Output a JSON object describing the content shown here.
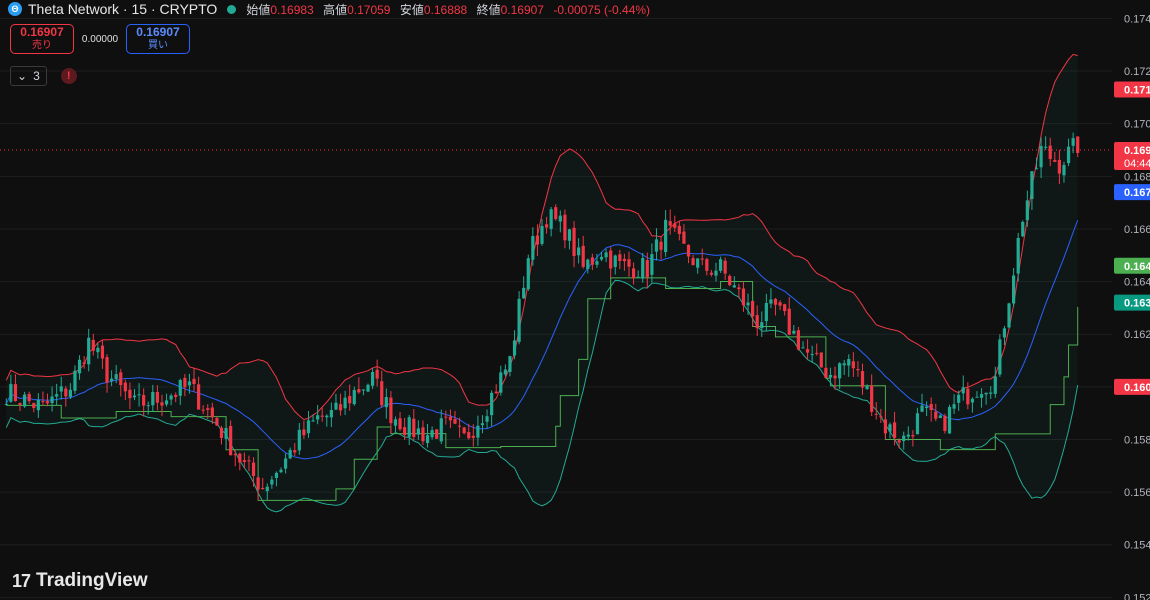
{
  "header": {
    "title": "Theta Network · 15 · CRYPTO",
    "icon": "theta-logo-icon",
    "ohlc": [
      {
        "label": "始値",
        "value": "0.16983"
      },
      {
        "label": "高値",
        "value": "0.17059"
      },
      {
        "label": "安値",
        "value": "0.16888"
      },
      {
        "label": "終値",
        "value": "0.16907"
      }
    ],
    "change": "-0.00075 (-0.44%)"
  },
  "trade": {
    "sell_price": "0.16907",
    "sell_label": "売り",
    "spread": "0.00000",
    "buy_price": "0.16907",
    "buy_label": "買い"
  },
  "indicators": {
    "count": "3",
    "warning": "!"
  },
  "logo": {
    "mark": "17",
    "text": "TradingView"
  },
  "colors": {
    "background": "#0f0f0f",
    "up": "#22ab94",
    "down": "#f23645",
    "bb_upper": "#f23645",
    "bb_lower": "#22ab94",
    "bb_basis": "#2962ff",
    "stop_line": "#4caf50"
  },
  "chart_data": {
    "type": "candlestick",
    "ylim": [
      0.1519,
      0.1747
    ],
    "y_ticks": [
      "0.174",
      "0.172",
      "0.170",
      "0.168",
      "0.166",
      "0.164",
      "0.162",
      "0.160",
      "0.158",
      "0.156",
      "0.154",
      "0.152"
    ],
    "current_price": 0.169,
    "price_labels": [
      {
        "text": "0.171",
        "value": 0.1713,
        "color": "#f23645"
      },
      {
        "text": "0.169",
        "sub": "04:44",
        "value": 0.169,
        "color": "#f23645"
      },
      {
        "text": "0.167",
        "value": 0.1674,
        "color": "#2962ff"
      },
      {
        "text": "0.164",
        "value": 0.1646,
        "color": "#4caf50"
      },
      {
        "text": "0.163",
        "value": 0.1632,
        "color": "#089981"
      },
      {
        "text": "0.160",
        "value": 0.16,
        "color": "#f23645"
      }
    ],
    "close_anchors": [
      [
        0,
        0.1598
      ],
      [
        8,
        0.1592
      ],
      [
        14,
        0.16
      ],
      [
        18,
        0.1617
      ],
      [
        22,
        0.1605
      ],
      [
        28,
        0.1593
      ],
      [
        34,
        0.1596
      ],
      [
        40,
        0.16
      ],
      [
        46,
        0.1586
      ],
      [
        52,
        0.157
      ],
      [
        56,
        0.1562
      ],
      [
        60,
        0.157
      ],
      [
        64,
        0.158
      ],
      [
        68,
        0.1588
      ],
      [
        72,
        0.159
      ],
      [
        76,
        0.1598
      ],
      [
        80,
        0.1603
      ],
      [
        84,
        0.159
      ],
      [
        88,
        0.1584
      ],
      [
        92,
        0.1582
      ],
      [
        96,
        0.1585
      ],
      [
        100,
        0.158
      ],
      [
        104,
        0.159
      ],
      [
        110,
        0.161
      ],
      [
        114,
        0.165
      ],
      [
        118,
        0.1665
      ],
      [
        122,
        0.166
      ],
      [
        126,
        0.1645
      ],
      [
        130,
        0.1652
      ],
      [
        134,
        0.1646
      ],
      [
        140,
        0.1645
      ],
      [
        144,
        0.166
      ],
      [
        148,
        0.1652
      ],
      [
        152,
        0.1645
      ],
      [
        156,
        0.1645
      ],
      [
        160,
        0.1635
      ],
      [
        164,
        0.1625
      ],
      [
        168,
        0.163
      ],
      [
        172,
        0.162
      ],
      [
        176,
        0.161
      ],
      [
        180,
        0.1605
      ],
      [
        184,
        0.161
      ],
      [
        188,
        0.1598
      ],
      [
        192,
        0.1585
      ],
      [
        196,
        0.158
      ],
      [
        200,
        0.159
      ],
      [
        204,
        0.1585
      ],
      [
        208,
        0.1595
      ],
      [
        212,
        0.16
      ],
      [
        216,
        0.1603
      ],
      [
        218,
        0.1625
      ],
      [
        222,
        0.1665
      ],
      [
        226,
        0.169
      ],
      [
        230,
        0.1685
      ],
      [
        234,
        0.1692
      ]
    ],
    "num_candles": 235
  }
}
